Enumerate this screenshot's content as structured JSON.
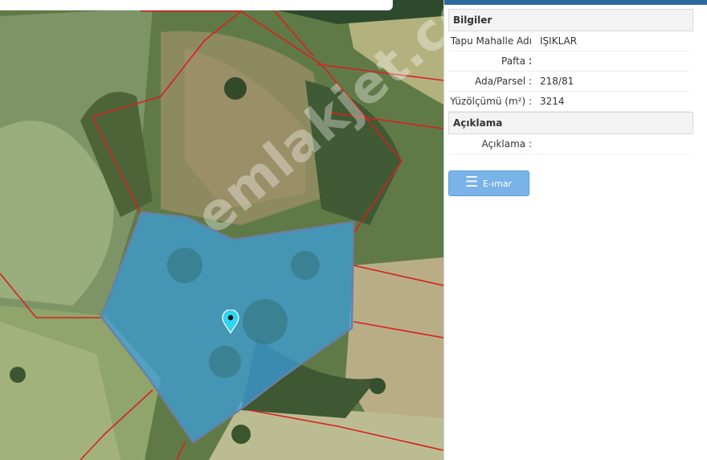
{
  "info_panel": {
    "title": "Bilgiler",
    "rows": [
      {
        "label": "Tapu Mahalle Adı :",
        "value": "IŞIKLAR"
      },
      {
        "label": "Pafta :",
        "value": ""
      },
      {
        "label": "Ada/Parsel :",
        "value": "218/81"
      },
      {
        "label": "Yüzölçümü (m²) :",
        "value": "3214"
      }
    ]
  },
  "description_panel": {
    "title": "Açıklama",
    "rows": [
      {
        "label": "Açıklama :",
        "value": ""
      }
    ]
  },
  "emar_button": {
    "label": "E-ımar",
    "icon": "menu-icon"
  },
  "map": {
    "watermark": "emlakjet.com",
    "marker_icon": "map-pin-icon",
    "colors": {
      "parcel_fill": "#3aa0e0",
      "boundary": "#d82020",
      "parcel_stroke": "#6b7fa8"
    }
  },
  "colors": {
    "topbar": "#2a6a9c",
    "button": "#7ab3e8"
  }
}
